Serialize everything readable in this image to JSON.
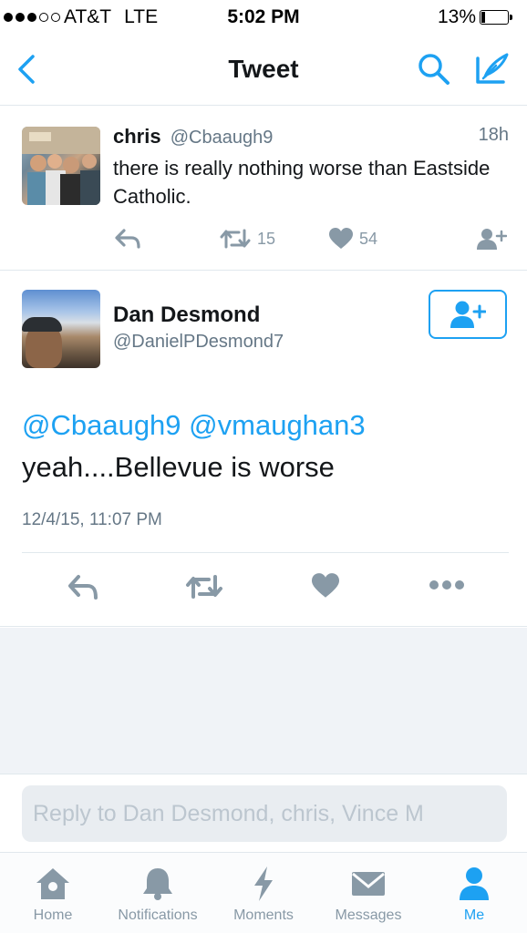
{
  "status_bar": {
    "carrier": "AT&T",
    "network": "LTE",
    "time": "5:02 PM",
    "battery": "13%",
    "battery_level": 0.13
  },
  "nav": {
    "title": "Tweet",
    "icons": [
      "back-chevron-icon",
      "search-icon",
      "compose-icon"
    ],
    "accent_color": "#1da1f2"
  },
  "parent_tweet": {
    "name": "chris",
    "handle": "@Cbaaugh9",
    "time": "18h",
    "text": "there is really nothing worse than Eastside Catholic.",
    "retweets": "15",
    "likes": "54"
  },
  "main_tweet": {
    "name": "Dan Desmond",
    "handle": "@DanielPDesmond7",
    "mention_1": "@Cbaaugh9",
    "mention_2": "@vmaughan3",
    "text": "yeah....Bellevue is worse",
    "date": "12/4/15, 11:07 PM"
  },
  "reply": {
    "placeholder": "Reply to Dan Desmond, chris, Vince M"
  },
  "tabs": [
    {
      "label": "Home",
      "icon": "home-icon"
    },
    {
      "label": "Notifications",
      "icon": "bell-icon"
    },
    {
      "label": "Moments",
      "icon": "lightning-icon"
    },
    {
      "label": "Messages",
      "icon": "envelope-icon"
    },
    {
      "label": "Me",
      "icon": "person-icon",
      "active": true
    }
  ],
  "colors": {
    "blue": "#1da1f2",
    "gray_icon": "#8899a6",
    "text_gray": "#657786"
  }
}
